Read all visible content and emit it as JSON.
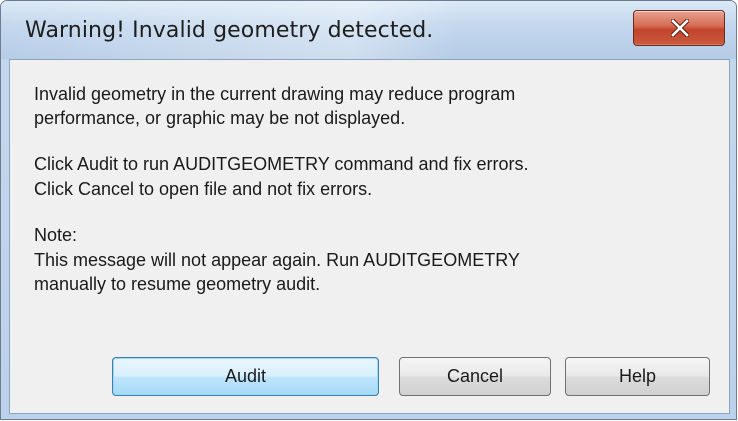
{
  "window": {
    "title": "Warning! Invalid geometry detected."
  },
  "message": {
    "line1": "Invalid geometry in the current drawing may reduce program",
    "line2": "performance, or graphic may be not displayed.",
    "line3": "Click Audit to run AUDITGEOMETRY command and fix errors.",
    "line4": "Click Cancel to open file and not fix errors.",
    "note_label": "Note:",
    "line5": "This message will not appear again. Run AUDITGEOMETRY",
    "line6": "manually to resume geometry audit."
  },
  "buttons": {
    "audit": "Audit",
    "cancel": "Cancel",
    "help": "Help"
  },
  "icons": {
    "close": "close-icon"
  },
  "colors": {
    "close_button": "#c95a3e",
    "default_button_border": "#3c7fb1",
    "client_background": "#f0f0f0"
  }
}
